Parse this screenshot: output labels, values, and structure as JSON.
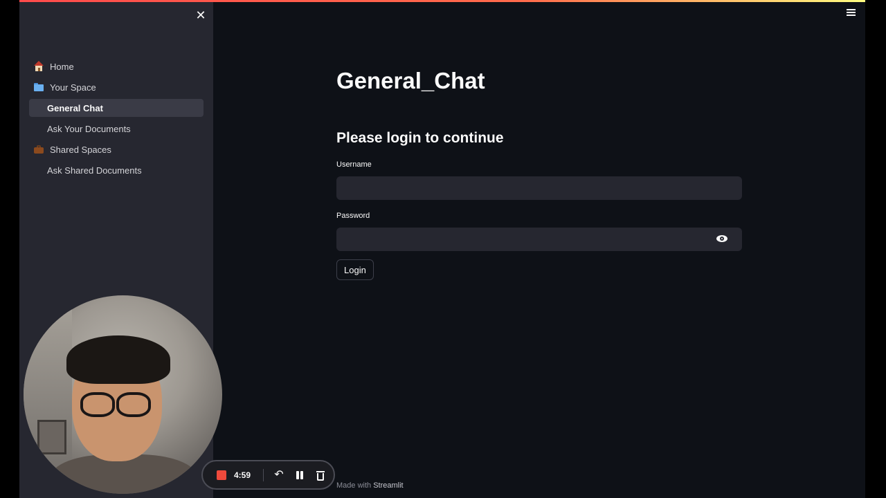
{
  "sidebar": {
    "close_icon": "close-icon",
    "items": [
      {
        "label": "Home",
        "icon": "house-icon"
      },
      {
        "label": "Your Space",
        "icon": "folder-icon"
      },
      {
        "label": "General Chat",
        "active": true
      },
      {
        "label": "Ask Your Documents"
      },
      {
        "label": "Shared Spaces",
        "icon": "briefcase-icon"
      },
      {
        "label": "Ask Shared Documents"
      }
    ]
  },
  "header": {
    "menu_icon": "hamburger-menu-icon"
  },
  "main": {
    "title": "General_Chat",
    "subtitle": "Please login to continue",
    "username_label": "Username",
    "username_value": "",
    "password_label": "Password",
    "password_value": "",
    "login_label": "Login"
  },
  "footer": {
    "prefix": "Made with",
    "brand": "Streamlit"
  },
  "recorder": {
    "time": "4:59"
  },
  "colors": {
    "background": "#0e1117",
    "sidebar": "#262730",
    "accent": "#ff4b4b",
    "record_stop": "#ef4a3c"
  }
}
